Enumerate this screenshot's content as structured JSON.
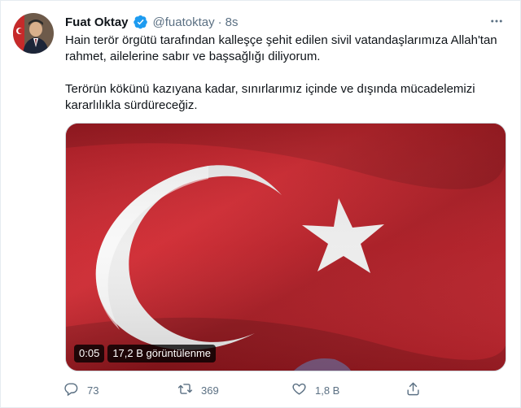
{
  "tweet": {
    "author_name": "Fuat Oktay",
    "handle": "@fuatoktay",
    "separator": "·",
    "time": "8s",
    "paragraphs": [
      "Hain terör örgütü tarafından kalleşçe şehit edilen sivil vatandaşlarımıza Allah'tan rahmet, ailelerine sabır ve başsağlığı diliyorum.",
      "Terörün kökünü kazıyana kadar, sınırlarımız içinde ve dışında mücadelemizi kararlılıkla sürdüreceğiz."
    ]
  },
  "media": {
    "duration": "0:05",
    "views": "17,2 B görüntülenme",
    "flag_red": "#c8232c",
    "flag_white": "#f2f2f2"
  },
  "actions": {
    "reply_count": "73",
    "retweet_count": "369",
    "like_count": "1,8 B"
  },
  "colors": {
    "verified": "#1d9bf0",
    "secondary_text": "#5b7083"
  }
}
